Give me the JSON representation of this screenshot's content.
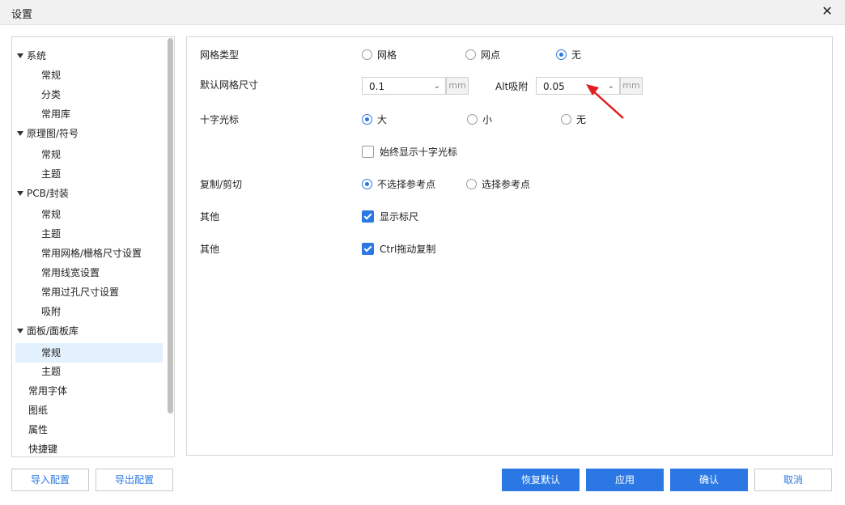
{
  "window": {
    "title": "设置"
  },
  "tree": {
    "items": [
      {
        "label": "系统",
        "level": 0,
        "parent": true
      },
      {
        "label": "常规",
        "level": 1
      },
      {
        "label": "分类",
        "level": 1
      },
      {
        "label": "常用库",
        "level": 1
      },
      {
        "label": "原理图/符号",
        "level": 0,
        "parent": true
      },
      {
        "label": "常规",
        "level": 1
      },
      {
        "label": "主题",
        "level": 1
      },
      {
        "label": "PCB/封装",
        "level": 0,
        "parent": true
      },
      {
        "label": "常规",
        "level": 1
      },
      {
        "label": "主题",
        "level": 1
      },
      {
        "label": "常用网格/栅格尺寸设置",
        "level": 1
      },
      {
        "label": "常用线宽设置",
        "level": 1
      },
      {
        "label": "常用过孔尺寸设置",
        "level": 1
      },
      {
        "label": "吸附",
        "level": 1
      },
      {
        "label": "面板/面板库",
        "level": 0,
        "parent": true
      },
      {
        "label": "常规",
        "level": 1,
        "selected": true
      },
      {
        "label": "主题",
        "level": 1
      },
      {
        "label": "常用字体",
        "level": 0
      },
      {
        "label": "图纸",
        "level": 0
      },
      {
        "label": "属性",
        "level": 0
      },
      {
        "label": "快捷键",
        "level": 0
      }
    ]
  },
  "settings": {
    "grid_type": {
      "label": "网格类型",
      "options": [
        "网格",
        "网点",
        "无"
      ],
      "selected": "无"
    },
    "grid_size": {
      "label": "默认网格尺寸",
      "value": "0.1",
      "unit": "mm",
      "alt_label": "Alt吸附",
      "alt_value": "0.05",
      "alt_unit": "mm"
    },
    "crosshair": {
      "label": "十字光标",
      "options": [
        "大",
        "小",
        "无"
      ],
      "selected": "大",
      "always_show": "始终显示十字光标",
      "always_show_checked": false
    },
    "copy_cut": {
      "label": "复制/剪切",
      "options": [
        "不选择参考点",
        "选择参考点"
      ],
      "selected": "不选择参考点"
    },
    "other1": {
      "label": "其他",
      "check_label": "显示标尺",
      "checked": true
    },
    "other2": {
      "label": "其他",
      "check_label": "Ctrl拖动复制",
      "checked": true
    }
  },
  "footer": {
    "import": "导入配置",
    "export": "导出配置",
    "restore": "恢复默认",
    "apply": "应用",
    "confirm": "确认",
    "cancel": "取消"
  },
  "colors": {
    "accent": "#2b78e4",
    "annotation_arrow": "#e02020"
  },
  "icons": {
    "close": "close-icon",
    "chevron": "chevron-down-icon",
    "tree_toggle": "caret-down-icon"
  }
}
